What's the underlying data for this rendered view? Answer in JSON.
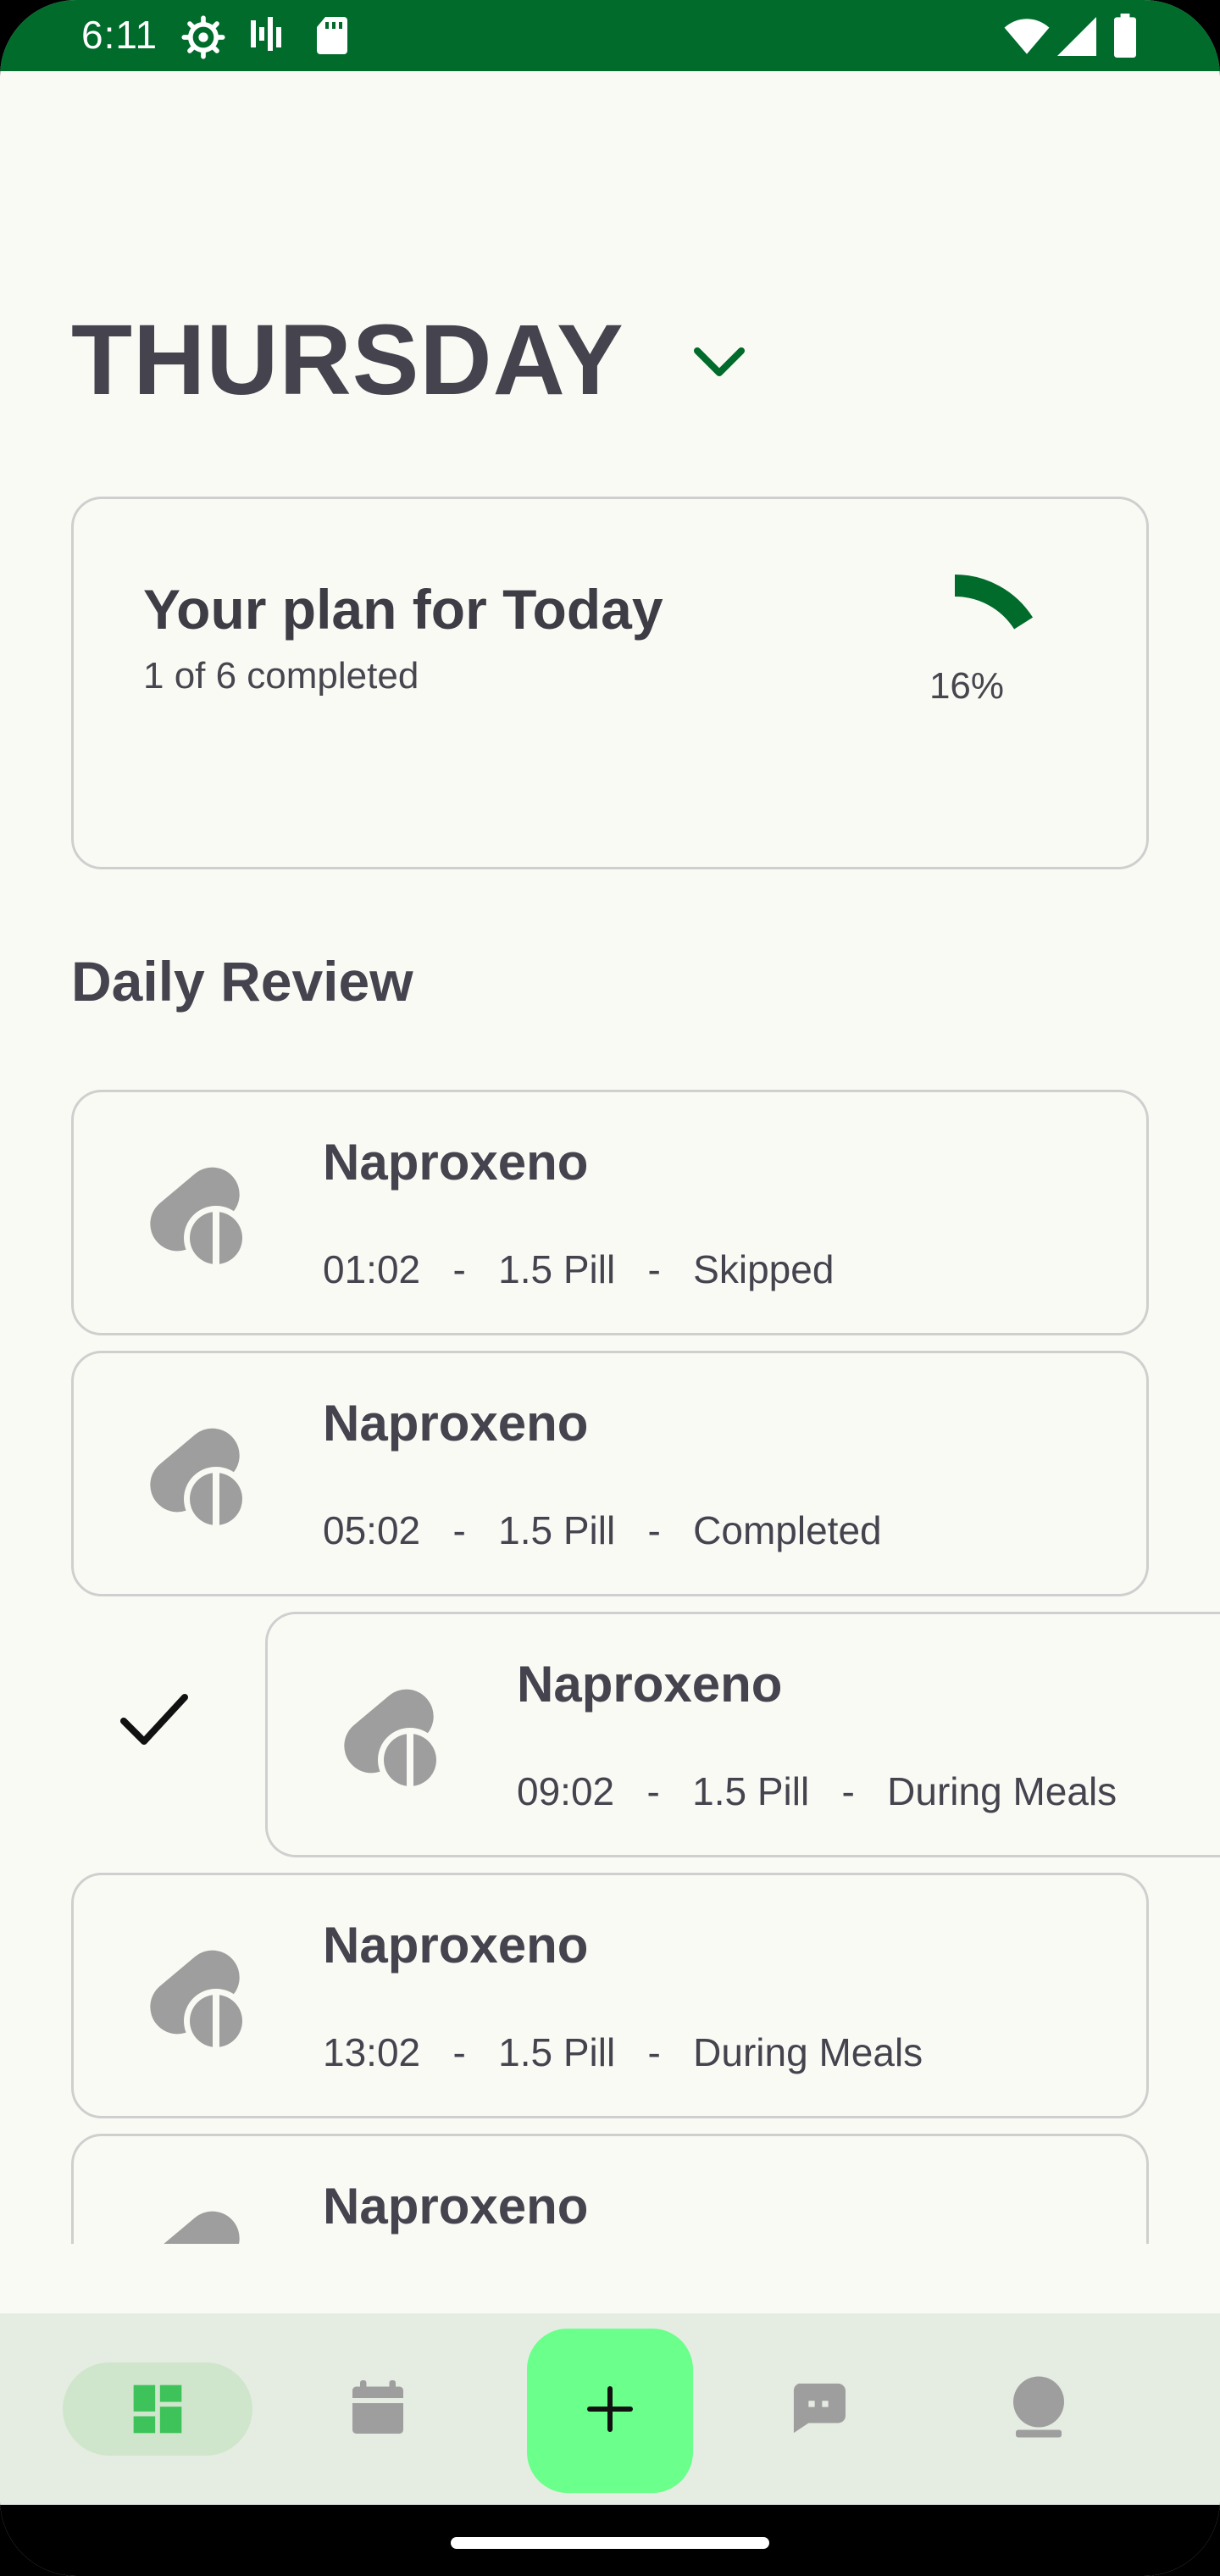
{
  "status_bar": {
    "time": "6:11",
    "left_icons": [
      "settings-icon",
      "signal-activity-icon",
      "sd-card-icon"
    ],
    "right_icons": [
      "wifi-icon",
      "cellular-icon",
      "battery-icon"
    ],
    "background": "#006b2a"
  },
  "header": {
    "day": "THURSDAY",
    "chevron_icon": "chevron-down-icon"
  },
  "plan": {
    "title": "Your plan for Today",
    "subtitle": "1 of 6 completed",
    "percent_label": "16%",
    "progress": 0.16,
    "accent": "#006b2a"
  },
  "daily_review": {
    "title": "Daily Review",
    "items": [
      {
        "name": "Naproxeno",
        "details": "01:02   -   1.5 Pill   -   Skipped"
      },
      {
        "name": "Naproxeno",
        "details": "05:02   -   1.5 Pill   -   Completed"
      },
      {
        "name": "Naproxeno",
        "details": "09:02   -   1.5 Pill   -   During Meals",
        "swiped": true
      },
      {
        "name": "Naproxeno",
        "details": "13:02   -   1.5 Pill   -   During Meals"
      },
      {
        "name": "Naproxeno",
        "details": ""
      }
    ],
    "swipe_action_icon": "check-icon"
  },
  "bottom_nav": {
    "items": [
      {
        "icon": "dashboard-icon",
        "selected": true
      },
      {
        "icon": "calendar-icon",
        "selected": false
      },
      {
        "icon": "add-icon",
        "selected": false
      },
      {
        "icon": "chat-icon",
        "selected": false
      },
      {
        "icon": "profile-icon",
        "selected": false
      }
    ],
    "fab_color": "#6bff8c",
    "selected_color": "#3ec25a"
  }
}
